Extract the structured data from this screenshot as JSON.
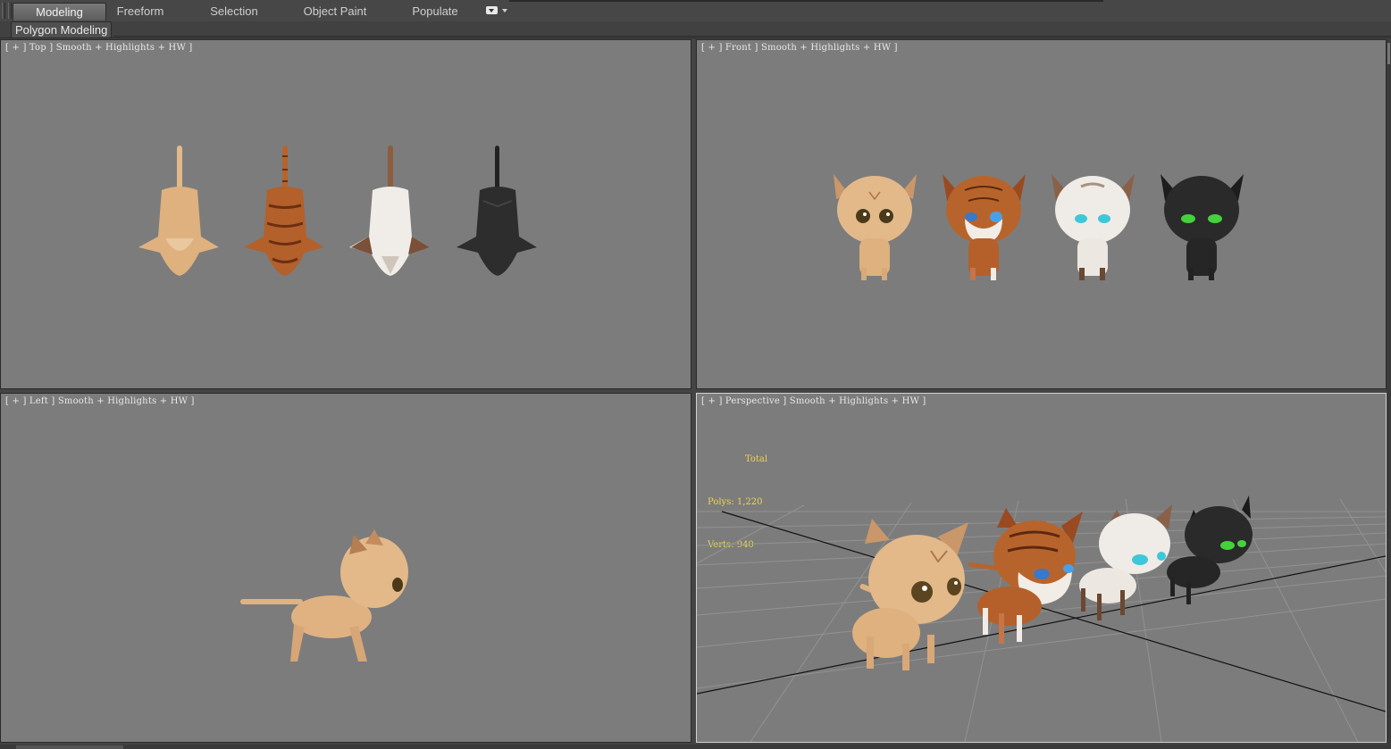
{
  "ribbon": {
    "tabs": [
      {
        "label": "Modeling",
        "active": true
      },
      {
        "label": "Freeform",
        "active": false
      },
      {
        "label": "Selection",
        "active": false
      },
      {
        "label": "Object Paint",
        "active": false
      },
      {
        "label": "Populate",
        "active": false
      }
    ],
    "extra_icon": "ribbon-options-dropdown-icon"
  },
  "subbar": {
    "panel_label": "Polygon Modeling"
  },
  "viewports": {
    "top": {
      "label": "[ + ] Top ] Smooth + Highlights + HW ]"
    },
    "front": {
      "label": "[ + ] Front ] Smooth + Highlights + HW ]"
    },
    "left": {
      "label": "[ + ] Left ] Smooth + Highlights + HW ]"
    },
    "persp": {
      "label": "[ + ] Perspective ] Smooth + Highlights + HW ]",
      "stats": {
        "heading": "Total",
        "polys": "Polys: 1,220",
        "verts": "Verts: 940"
      }
    }
  },
  "models": [
    {
      "name": "ginger-cat",
      "fur": "#e2b486",
      "eyes": "#8a7a3a"
    },
    {
      "name": "tabby-cat",
      "fur": "#b05a2a",
      "eyes": "#4aa0e8"
    },
    {
      "name": "white-cat",
      "fur": "#ede9e4",
      "eyes": "#3cc8d8"
    },
    {
      "name": "black-cat",
      "fur": "#2a2a2a",
      "eyes": "#44d23c"
    }
  ],
  "colors": {
    "accent_stats": "#ecd44c",
    "viewport_bg": "#7c7c7c"
  }
}
